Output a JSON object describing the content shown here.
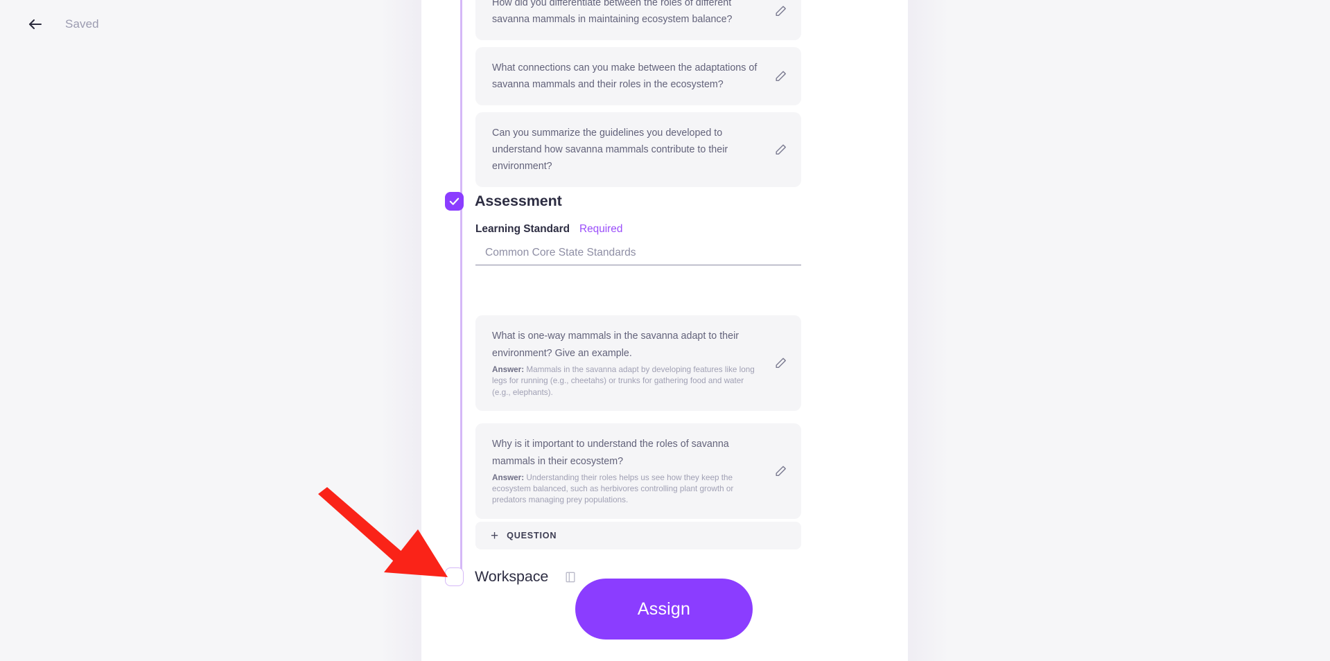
{
  "header": {
    "back_icon": "arrow-left-icon",
    "status_label": "Saved"
  },
  "colors": {
    "accent_purple": "#8b3dff",
    "required_purple": "#9a4dfa",
    "timeline_purple": "#d5b8f7",
    "card_bg": "#f5f5f7",
    "panel_bg": "#ffffff",
    "page_bg": "#f6f6f8",
    "annotation_red": "#fa2318",
    "text_dark": "#2d2d42",
    "text_muted": "#62627a",
    "text_faint": "#a0a0b4"
  },
  "discussion_questions": [
    {
      "text": "How did you differentiate between the roles of different savanna mammals in maintaining ecosystem balance?",
      "edit_icon": "pencil-icon"
    },
    {
      "text": "What connections can you make between the adaptations of savanna mammals and their roles in the ecosystem?",
      "edit_icon": "pencil-icon"
    },
    {
      "text": "Can you summarize the guidelines you developed to understand how savanna mammals contribute to their environment?",
      "edit_icon": "pencil-icon"
    }
  ],
  "assessment": {
    "checkbox_state": "checked",
    "check_icon": "check-icon",
    "title": "Assessment",
    "learning_standard": {
      "label": "Learning Standard",
      "required_label": "Required",
      "value": "",
      "placeholder": "Common Core State Standards"
    },
    "questions": [
      {
        "question": "What is one-way mammals in the savanna adapt to their environment? Give an example.",
        "answer_label": "Answer:",
        "answer": "Mammals in the savanna adapt by developing features like long legs for running (e.g., cheetahs) or trunks for gathering food and water (e.g., elephants).",
        "edit_icon": "pencil-icon"
      },
      {
        "question": "Why is it important to understand the roles of savanna mammals in their ecosystem?",
        "answer_label": "Answer:",
        "answer": "Understanding their roles helps us see how they keep the ecosystem balanced, such as herbivores controlling plant growth or predators managing prey populations.",
        "edit_icon": "pencil-icon"
      }
    ],
    "add_question_label": "QUESTION",
    "add_question_plus": "+"
  },
  "workspace": {
    "checkbox_state": "unchecked",
    "title": "Workspace",
    "icon": "workspace-panel-icon"
  },
  "footer": {
    "assign_label": "Assign"
  },
  "annotation": {
    "type": "arrow",
    "color": "#fa2318",
    "points_to": "workspace-checkbox"
  }
}
